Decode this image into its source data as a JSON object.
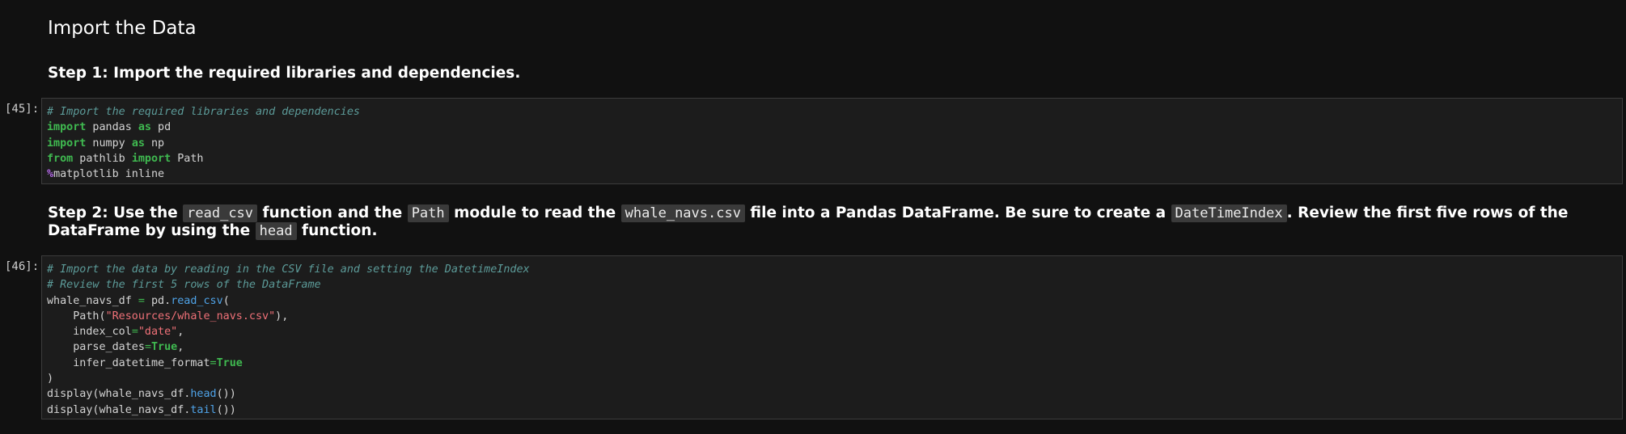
{
  "heading": "Import the Data",
  "step1": {
    "text": "Step 1: Import the required libraries and dependencies."
  },
  "cell1": {
    "prompt": "[45]:",
    "comment": "# Import the required libraries and dependencies",
    "kw_import": "import",
    "kw_as": "as",
    "kw_from": "from",
    "pandas": " pandas ",
    "pd": " pd",
    "numpy": " numpy ",
    "np": " np",
    "pathlib": " pathlib ",
    "path": " Path",
    "magic_symbol": "%",
    "magic_rest": "matplotlib inline"
  },
  "step2": {
    "t1": "Step 2: Use the ",
    "c1": "read_csv",
    "t2": " function and the ",
    "c2": "Path",
    "t3": " module to read the ",
    "c3": "whale_navs.csv",
    "t4": " file into a Pandas DataFrame. Be sure to create a ",
    "c4": "DateTimeIndex",
    "t5": ". Review the first five rows of the DataFrame by using the ",
    "c5": "head",
    "t6": " function."
  },
  "cell2": {
    "prompt": "[46]:",
    "comment1": "# Import the data by reading in the CSV file and setting the DatetimeIndex",
    "comment2": "# Review the first 5 rows of the DataFrame",
    "var": "whale_navs_df ",
    "eq": "=",
    "pd_dot": " pd.",
    "read_csv": "read_csv",
    "open_paren": "(",
    "path_open": "    Path(",
    "path_str": "\"Resources/whale_navs.csv\"",
    "path_close": "),",
    "index_col": "    index_col",
    "eq2": "=",
    "date_str": "\"date\"",
    "comma": ",",
    "parse_dates": "    parse_dates",
    "eq3": "=",
    "true1": "True",
    "comma2": ",",
    "infer": "    infer_datetime_format",
    "eq4": "=",
    "true2": "True",
    "close_paren": ")",
    "disp1_a": "display(whale_navs_df.",
    "head": "head",
    "disp1_b": "())",
    "disp2_a": "display(whale_navs_df.",
    "tail": "tail",
    "disp2_b": "())"
  }
}
